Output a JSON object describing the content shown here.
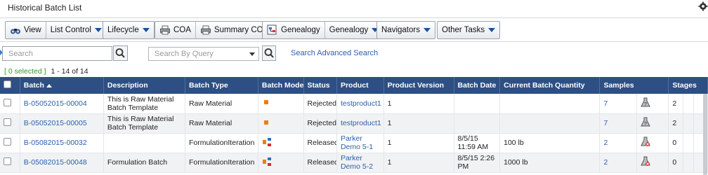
{
  "window": {
    "title": "Historical Batch List"
  },
  "toolbar": {
    "groups": [
      {
        "buttons": [
          {
            "label": "View",
            "icon": "binoculars-icon"
          },
          {
            "label": "List Control",
            "dropdown": true
          }
        ]
      },
      {
        "buttons": [
          {
            "label": "Lifecycle",
            "dropdown": true
          }
        ]
      },
      {
        "buttons": [
          {
            "label": "COA",
            "icon": "printer-icon"
          },
          {
            "label": "Summary COA",
            "icon": "printer-icon"
          }
        ]
      },
      {
        "buttons": [
          {
            "label": "Genealogy",
            "icon": "genealogy-icon"
          },
          {
            "label": "Genealogy",
            "dropdown": true
          }
        ]
      },
      {
        "buttons": [
          {
            "label": "Navigators",
            "dropdown": true
          }
        ]
      },
      {
        "buttons": [
          {
            "label": "Other Tasks",
            "dropdown": true
          }
        ]
      }
    ]
  },
  "search": {
    "placeholder": "Search",
    "query_placeholder": "Search By Query",
    "advanced_link": "Search Advanced Search"
  },
  "selection": {
    "selected": "[ 0 selected ]",
    "count": "1 - 14 of 14"
  },
  "table": {
    "columns": [
      "Batch",
      "Description",
      "Batch Type",
      "Batch Mode",
      "Status",
      "Product",
      "Product Version",
      "Batch Date",
      "Current Batch Quantity",
      "Samples",
      "Stages"
    ],
    "rows": [
      {
        "batch": "B-05052015-00004",
        "description": "This is Raw Material Batch Template",
        "batch_type": "Raw Material",
        "mode_icon": "single-square-icon",
        "status": "Rejected",
        "product": "testproduct1",
        "product_version": "1",
        "batch_date": "",
        "quantity": "",
        "samples": "7",
        "sample_icon": "flask-question-icon",
        "stages": "2"
      },
      {
        "batch": "B-05052015-00005",
        "description": "This is Raw Material Batch Template",
        "batch_type": "Raw Material",
        "mode_icon": "single-square-icon",
        "status": "Rejected",
        "product": "testproduct1",
        "product_version": "1",
        "batch_date": "",
        "quantity": "",
        "samples": "7",
        "sample_icon": "flask-question-icon",
        "stages": "2"
      },
      {
        "batch": "B-05082015-00032",
        "description": "",
        "batch_type": "FormulationIteration",
        "mode_icon": "branch-squares-icon",
        "status": "Released",
        "product": "Parker Demo 5-1",
        "product_version": "1",
        "batch_date": "8/5/15 11:59 AM",
        "quantity": "100 lb",
        "samples": "2",
        "sample_icon": "flask-error-icon",
        "stages": "0"
      },
      {
        "batch": "B-05082015-00048",
        "description": "Formulation Batch",
        "batch_type": "FormulationIteration",
        "mode_icon": "branch-squares-icon",
        "status": "Released",
        "product": "Parker Demo 5-2",
        "product_version": "1",
        "batch_date": "8/5/15 2:26 PM",
        "quantity": "1000 lb",
        "samples": "2",
        "sample_icon": "flask-error-icon",
        "stages": "0"
      }
    ]
  },
  "colors": {
    "header_bg": "#2d4f83",
    "link": "#2d5fa8",
    "selected_text": "#2e9a2e"
  }
}
